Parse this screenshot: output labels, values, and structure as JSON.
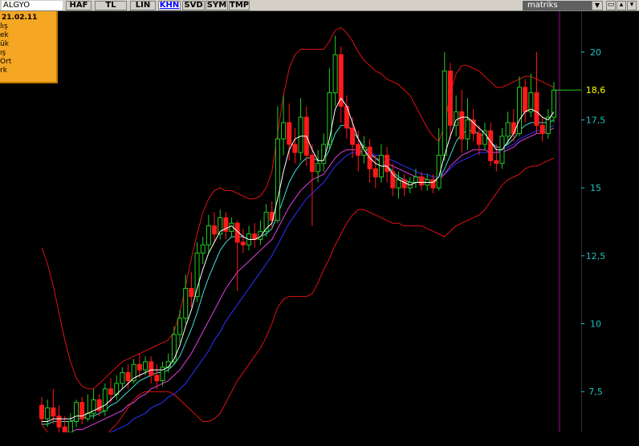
{
  "toolbar": {
    "symbol": "ALGYO",
    "buttons": [
      {
        "label": "HAF",
        "active": false
      },
      {
        "label": "TL",
        "active": false
      },
      {
        "label": "LIN",
        "active": false
      },
      {
        "label": "KHN",
        "active": true
      },
      {
        "label": "SVD",
        "active": false
      },
      {
        "label": "SYM",
        "active": false
      },
      {
        "label": "TMP",
        "active": false
      }
    ],
    "brand": "matriks",
    "dropdown_glyph": "▼",
    "window_buttons": [
      "▭",
      "▴",
      "▾"
    ]
  },
  "info_box": {
    "date": "21.02.11",
    "rows": [
      "lış",
      "ek",
      "ük",
      "ış",
      "Ort",
      "rk"
    ]
  },
  "colors": {
    "background": "#000000",
    "toolbar": "#d4d0c8",
    "info_box": "#f5a623",
    "up_candle": "#22cc22",
    "down_candle": "#ff1a1a",
    "bollinger": "#e01010",
    "ma_white": "#ffffff",
    "ma_cyan": "#40e0d0",
    "ma_magenta": "#e040e0",
    "ma_blue": "#3030ff",
    "axis_text": "#20c0c0",
    "last_price": "#ffff00",
    "date_marker": "#a000a0"
  },
  "chart_data": {
    "type": "candlestick",
    "y_axis_ticks": [
      7.5,
      10,
      12.5,
      15,
      17.5,
      20
    ],
    "y_axis_labels": [
      "7,5",
      "10",
      "12,5",
      "15",
      "17,5",
      "20"
    ],
    "ylim": [
      6.0,
      21.5
    ],
    "last_price": 18.6,
    "last_price_label": "18,6",
    "candles": [
      [
        7.0,
        6.5,
        7.3,
        6.3
      ],
      [
        6.5,
        6.9,
        7.2,
        6.2
      ],
      [
        6.9,
        6.6,
        7.6,
        6.3
      ],
      [
        6.6,
        6.2,
        7.0,
        5.9
      ],
      [
        6.2,
        6.0,
        6.6,
        5.8
      ],
      [
        6.0,
        6.4,
        6.7,
        5.8
      ],
      [
        6.4,
        7.1,
        7.2,
        6.2
      ],
      [
        7.1,
        6.5,
        7.3,
        6.3
      ],
      [
        6.5,
        6.7,
        7.4,
        6.4
      ],
      [
        6.7,
        7.2,
        7.6,
        6.5
      ],
      [
        7.2,
        6.8,
        7.4,
        6.6
      ],
      [
        6.8,
        7.6,
        7.8,
        6.6
      ],
      [
        7.6,
        7.4,
        8.0,
        7.1
      ],
      [
        7.4,
        7.8,
        8.1,
        7.2
      ],
      [
        7.8,
        8.2,
        8.4,
        7.6
      ],
      [
        8.2,
        7.9,
        8.5,
        7.6
      ],
      [
        7.9,
        8.5,
        8.7,
        7.8
      ],
      [
        8.5,
        8.3,
        8.9,
        8.0
      ],
      [
        8.3,
        8.6,
        8.8,
        8.1
      ],
      [
        8.6,
        8.1,
        8.8,
        7.8
      ],
      [
        8.1,
        7.9,
        8.5,
        7.6
      ],
      [
        7.9,
        8.4,
        8.6,
        7.7
      ],
      [
        8.4,
        8.6,
        8.9,
        8.2
      ],
      [
        8.6,
        9.6,
        9.9,
        8.5
      ],
      [
        9.6,
        10.2,
        10.5,
        9.3
      ],
      [
        10.2,
        11.3,
        11.8,
        10.0
      ],
      [
        11.3,
        11.0,
        11.9,
        10.6
      ],
      [
        11.0,
        12.6,
        13.0,
        10.8
      ],
      [
        12.6,
        12.9,
        13.2,
        12.2
      ],
      [
        12.9,
        13.6,
        14.0,
        12.6
      ],
      [
        13.6,
        13.3,
        14.1,
        13.0
      ],
      [
        13.3,
        13.9,
        14.2,
        13.1
      ],
      [
        13.9,
        13.4,
        14.1,
        13.1
      ],
      [
        13.4,
        13.7,
        13.9,
        13.2
      ],
      [
        13.7,
        13.0,
        13.8,
        11.2
      ],
      [
        13.0,
        12.9,
        13.5,
        12.6
      ],
      [
        12.9,
        13.3,
        13.6,
        12.7
      ],
      [
        13.3,
        13.1,
        13.7,
        12.8
      ],
      [
        13.1,
        13.4,
        13.8,
        12.9
      ],
      [
        13.4,
        14.1,
        14.4,
        13.2
      ],
      [
        14.1,
        13.8,
        14.5,
        13.5
      ],
      [
        13.8,
        16.8,
        18.0,
        13.7
      ],
      [
        16.8,
        17.4,
        18.4,
        16.2
      ],
      [
        17.4,
        16.6,
        18.1,
        16.0
      ],
      [
        16.6,
        16.3,
        17.2,
        15.9
      ],
      [
        16.3,
        17.6,
        18.3,
        16.0
      ],
      [
        17.6,
        16.2,
        18.0,
        15.8
      ],
      [
        16.2,
        15.6,
        16.6,
        13.6
      ],
      [
        15.6,
        15.9,
        16.4,
        15.2
      ],
      [
        15.9,
        16.6,
        17.0,
        15.6
      ],
      [
        16.6,
        18.5,
        19.4,
        16.4
      ],
      [
        18.5,
        19.9,
        20.6,
        18.0
      ],
      [
        19.9,
        18.0,
        20.2,
        17.4
      ],
      [
        18.0,
        17.2,
        18.4,
        16.8
      ],
      [
        17.2,
        16.6,
        17.6,
        16.1
      ],
      [
        16.6,
        16.2,
        17.1,
        15.6
      ],
      [
        16.2,
        16.5,
        16.9,
        15.9
      ],
      [
        16.5,
        15.7,
        16.8,
        15.2
      ],
      [
        15.7,
        15.4,
        16.2,
        15.0
      ],
      [
        15.4,
        16.2,
        16.6,
        15.2
      ],
      [
        16.2,
        15.6,
        16.5,
        15.2
      ],
      [
        15.6,
        15.0,
        15.9,
        14.7
      ],
      [
        15.0,
        15.3,
        15.6,
        14.6
      ],
      [
        15.3,
        15.0,
        15.5,
        14.7
      ],
      [
        15.0,
        15.2,
        15.4,
        14.8
      ],
      [
        15.2,
        15.4,
        15.7,
        15.0
      ],
      [
        15.4,
        15.1,
        15.6,
        14.9
      ],
      [
        15.1,
        15.3,
        15.5,
        14.9
      ],
      [
        15.3,
        15.0,
        15.5,
        14.8
      ],
      [
        15.0,
        16.2,
        17.2,
        14.9
      ],
      [
        16.2,
        19.3,
        20.0,
        16.0
      ],
      [
        19.3,
        17.3,
        19.6,
        16.8
      ],
      [
        17.3,
        17.8,
        18.4,
        16.9
      ],
      [
        17.8,
        16.8,
        18.6,
        16.3
      ],
      [
        16.8,
        17.5,
        18.3,
        16.4
      ],
      [
        17.5,
        17.0,
        17.9,
        16.7
      ],
      [
        17.0,
        16.6,
        17.3,
        16.2
      ],
      [
        16.6,
        17.1,
        17.4,
        16.4
      ],
      [
        17.1,
        16.0,
        17.4,
        15.8
      ],
      [
        16.0,
        15.9,
        16.6,
        15.6
      ],
      [
        15.9,
        16.9,
        17.2,
        15.7
      ],
      [
        16.9,
        17.4,
        17.8,
        16.6
      ],
      [
        17.4,
        17.0,
        17.9,
        16.7
      ],
      [
        17.0,
        18.7,
        19.1,
        16.9
      ],
      [
        18.7,
        17.8,
        19.0,
        17.4
      ],
      [
        17.8,
        18.5,
        19.2,
        17.6
      ],
      [
        18.5,
        17.3,
        20.0,
        17.0
      ],
      [
        17.3,
        17.0,
        17.6,
        16.7
      ],
      [
        17.0,
        17.6,
        17.9,
        16.8
      ],
      [
        17.6,
        18.6,
        18.9,
        17.4
      ]
    ],
    "indicators": {
      "ma_white": [
        6.4,
        6.4,
        6.5,
        6.5,
        6.5,
        6.5,
        6.6,
        6.6,
        6.7,
        6.8,
        6.9,
        7.0,
        7.2,
        7.4,
        7.6,
        7.8,
        8.0,
        8.1,
        8.2,
        8.3,
        8.3,
        8.3,
        8.4,
        8.7,
        9.2,
        9.9,
        10.5,
        11.3,
        12.0,
        12.6,
        13.0,
        13.4,
        13.5,
        13.6,
        13.4,
        13.2,
        13.1,
        13.1,
        13.2,
        13.5,
        13.7,
        14.6,
        15.6,
        16.4,
        16.8,
        16.9,
        16.9,
        16.4,
        16.0,
        16.0,
        16.8,
        17.9,
        18.3,
        18.0,
        17.4,
        16.8,
        16.4,
        16.1,
        15.9,
        15.8,
        15.8,
        15.5,
        15.3,
        15.2,
        15.1,
        15.2,
        15.2,
        15.2,
        15.2,
        15.4,
        16.2,
        16.9,
        17.5,
        17.6,
        17.6,
        17.4,
        17.2,
        17.0,
        16.7,
        16.4,
        16.4,
        16.7,
        17.0,
        17.5,
        17.8,
        17.9,
        17.8,
        17.6,
        17.5,
        17.8
      ],
      "ma_cyan": [
        6.3,
        6.3,
        6.4,
        6.4,
        6.4,
        6.4,
        6.5,
        6.5,
        6.6,
        6.6,
        6.7,
        6.8,
        7.0,
        7.1,
        7.3,
        7.5,
        7.7,
        7.9,
        8.0,
        8.1,
        8.2,
        8.2,
        8.3,
        8.5,
        8.8,
        9.3,
        9.8,
        10.4,
        11.1,
        11.7,
        12.2,
        12.7,
        13.0,
        13.2,
        13.2,
        13.2,
        13.1,
        13.1,
        13.2,
        13.3,
        13.5,
        14.0,
        14.6,
        15.2,
        15.6,
        15.9,
        16.1,
        16.1,
        16.0,
        16.0,
        16.4,
        17.0,
        17.3,
        17.3,
        17.1,
        16.8,
        16.5,
        16.3,
        16.1,
        15.9,
        15.8,
        15.6,
        15.4,
        15.3,
        15.2,
        15.2,
        15.2,
        15.2,
        15.2,
        15.3,
        15.7,
        16.2,
        16.7,
        17.0,
        17.1,
        17.1,
        17.0,
        16.9,
        16.7,
        16.5,
        16.5,
        16.6,
        16.8,
        17.1,
        17.3,
        17.4,
        17.4,
        17.4,
        17.4,
        17.5
      ],
      "ma_magenta": [
        5.8,
        5.8,
        5.9,
        5.9,
        6.0,
        6.0,
        6.1,
        6.1,
        6.2,
        6.3,
        6.4,
        6.5,
        6.6,
        6.7,
        6.8,
        7.0,
        7.1,
        7.3,
        7.4,
        7.6,
        7.7,
        7.8,
        7.9,
        8.1,
        8.3,
        8.6,
        8.9,
        9.3,
        9.7,
        10.1,
        10.5,
        10.9,
        11.3,
        11.6,
        11.9,
        12.1,
        12.3,
        12.5,
        12.7,
        12.9,
        13.1,
        13.5,
        13.9,
        14.3,
        14.6,
        14.9,
        15.1,
        15.3,
        15.4,
        15.5,
        15.8,
        16.1,
        16.3,
        16.4,
        16.4,
        16.4,
        16.3,
        16.2,
        16.1,
        16.0,
        15.9,
        15.8,
        15.7,
        15.6,
        15.5,
        15.4,
        15.4,
        15.3,
        15.3,
        15.3,
        15.5,
        15.8,
        16.0,
        16.2,
        16.3,
        16.4,
        16.4,
        16.4,
        16.3,
        16.3,
        16.3,
        16.4,
        16.5,
        16.7,
        16.8,
        16.9,
        17.0,
        17.0,
        17.1,
        17.2
      ],
      "ma_blue": [
        5.2,
        5.2,
        5.3,
        5.3,
        5.4,
        5.4,
        5.5,
        5.6,
        5.6,
        5.7,
        5.8,
        5.9,
        6.0,
        6.1,
        6.2,
        6.3,
        6.5,
        6.6,
        6.7,
        6.9,
        7.0,
        7.1,
        7.3,
        7.4,
        7.6,
        7.8,
        8.1,
        8.4,
        8.7,
        9.0,
        9.4,
        9.7,
        10.1,
        10.4,
        10.7,
        11.0,
        11.3,
        11.6,
        11.9,
        12.2,
        12.5,
        12.9,
        13.3,
        13.7,
        14.0,
        14.3,
        14.6,
        14.8,
        15.0,
        15.2,
        15.5,
        15.8,
        16.0,
        16.2,
        16.3,
        16.3,
        16.3,
        16.3,
        16.2,
        16.2,
        16.1,
        16.0,
        15.9,
        15.8,
        15.7,
        15.6,
        15.5,
        15.5,
        15.4,
        15.4,
        15.5,
        15.7,
        15.9,
        16.0,
        16.1,
        16.2,
        16.3,
        16.3,
        16.3,
        16.3,
        16.4,
        16.5,
        16.6,
        16.8,
        16.9,
        17.0,
        17.1,
        17.1,
        17.2,
        17.3
      ],
      "bb_upper": [
        12.8,
        12.2,
        11.4,
        10.4,
        9.4,
        8.6,
        8.0,
        7.7,
        7.6,
        7.6,
        7.8,
        8.0,
        8.2,
        8.4,
        8.6,
        8.7,
        8.8,
        8.9,
        9.0,
        9.1,
        9.2,
        9.3,
        9.4,
        9.7,
        10.4,
        11.4,
        12.4,
        13.3,
        14.1,
        14.6,
        14.9,
        15.0,
        14.9,
        14.9,
        14.8,
        14.7,
        14.6,
        14.6,
        14.7,
        15.0,
        15.6,
        17.0,
        18.4,
        19.4,
        19.9,
        20.1,
        20.1,
        20.1,
        20.1,
        20.1,
        20.4,
        20.8,
        20.9,
        20.7,
        20.4,
        20.0,
        19.7,
        19.5,
        19.3,
        19.2,
        19.0,
        18.9,
        18.8,
        18.6,
        18.4,
        18.0,
        17.6,
        17.2,
        16.9,
        16.7,
        17.3,
        18.5,
        19.2,
        19.5,
        19.5,
        19.4,
        19.3,
        19.1,
        18.9,
        18.7,
        18.7,
        18.8,
        18.9,
        19.0,
        19.1,
        19.1,
        19.0,
        18.9,
        18.8,
        18.7
      ],
      "bb_lower": [
        6.3,
        6.0,
        5.7,
        5.5,
        5.3,
        5.1,
        5.1,
        5.2,
        5.3,
        5.5,
        5.6,
        5.8,
        6.1,
        6.3,
        6.6,
        6.9,
        7.2,
        7.4,
        7.5,
        7.5,
        7.5,
        7.5,
        7.5,
        7.4,
        7.2,
        7.0,
        6.8,
        6.6,
        6.4,
        6.4,
        6.5,
        6.7,
        7.1,
        7.5,
        7.9,
        8.2,
        8.5,
        8.8,
        9.1,
        9.5,
        10.0,
        10.6,
        10.9,
        11.0,
        11.0,
        11.0,
        11.0,
        11.1,
        11.5,
        12.0,
        12.4,
        12.9,
        13.3,
        13.7,
        14.0,
        14.2,
        14.2,
        14.1,
        14.0,
        13.9,
        13.8,
        13.7,
        13.7,
        13.6,
        13.6,
        13.6,
        13.6,
        13.5,
        13.4,
        13.3,
        13.2,
        13.4,
        13.6,
        13.7,
        13.8,
        13.9,
        14.0,
        14.2,
        14.5,
        14.8,
        15.1,
        15.3,
        15.4,
        15.5,
        15.7,
        15.8,
        15.8,
        15.9,
        16.0,
        16.1
      ]
    }
  }
}
